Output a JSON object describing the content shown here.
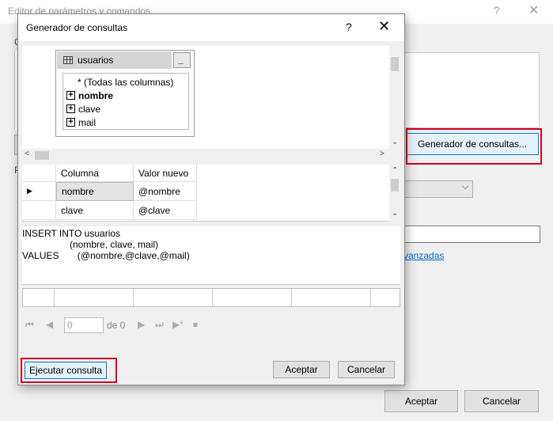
{
  "back_window": {
    "title": "Editor de parámetros y comandos",
    "help": "?",
    "close": "✕",
    "query_builder_button": "Generador de consultas...",
    "advanced_link": "vanzadas",
    "ok": "Aceptar",
    "cancel": "Cancelar",
    "letter_c": "C",
    "letter_p": "P"
  },
  "dialog": {
    "title": "Generador de consultas",
    "help": "?",
    "close": "✕",
    "table": {
      "name": "usuarios",
      "minimize": "_",
      "all_columns": "* (Todas las columnas)",
      "columns": [
        "nombre",
        "clave",
        "mail"
      ]
    },
    "grid": {
      "headers": [
        "Columna",
        "Valor nuevo"
      ],
      "rows": [
        {
          "column": "nombre",
          "value": "@nombre"
        },
        {
          "column": "clave",
          "value": "@clave"
        }
      ]
    },
    "sql": {
      "line1": "INSERT INTO usuarios",
      "line2": "                  (nombre, clave, mail)",
      "line3": "VALUES       (@nombre,@clave,@mail)"
    },
    "nav": {
      "page": "0",
      "of": "de 0"
    },
    "execute_button": "Ejecutar consulta",
    "ok_button": "Aceptar",
    "cancel_button": "Cancelar"
  },
  "colors": {
    "highlight": "#d0021b",
    "focus_border": "#0078d7"
  }
}
